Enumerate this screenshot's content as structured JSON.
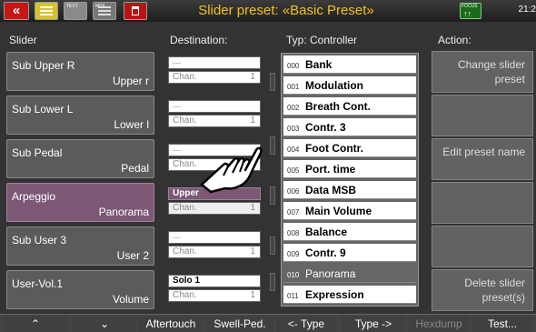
{
  "titlebar": {
    "title": "Slider preset: «Basic Preset»",
    "back_icon": "double-chevron-left-icon",
    "clock": "21:2",
    "icon_mini_labels": [
      "TEXT",
      "MIDI"
    ],
    "green_icon_label": "FOCUS"
  },
  "headers": {
    "slider": "Slider",
    "destination": "Destination:",
    "type": "Typ:  Controller",
    "action": "Action:"
  },
  "sliders": [
    {
      "name": "Sub Upper R",
      "sub": "Upper r"
    },
    {
      "name": "Sub Lower L",
      "sub": "Lower l"
    },
    {
      "name": "Sub Pedal",
      "sub": "Pedal"
    },
    {
      "name": "Arpeggio",
      "sub": "Panorama"
    },
    {
      "name": "Sub User 3",
      "sub": "User 2"
    },
    {
      "name": "User-Vol.1",
      "sub": "Volume"
    }
  ],
  "destinations": [
    {
      "top": "---",
      "chan": "Chan.",
      "num": "1"
    },
    {
      "top": "---",
      "chan": "Chan.",
      "num": "1"
    },
    {
      "top": "---",
      "chan": "Chan.",
      "num": "1"
    },
    {
      "top": "Upper",
      "chan": "Chan.",
      "num": "1"
    },
    {
      "top": "---",
      "chan": "Chan.",
      "num": "1"
    },
    {
      "top": "Solo 1",
      "chan": "Chan.",
      "num": "1"
    }
  ],
  "types": [
    {
      "num": "000",
      "label": "Bank"
    },
    {
      "num": "001",
      "label": "Modulation"
    },
    {
      "num": "002",
      "label": "Breath Cont."
    },
    {
      "num": "003",
      "label": "Contr. 3"
    },
    {
      "num": "004",
      "label": "Foot Contr."
    },
    {
      "num": "005",
      "label": "Port. time"
    },
    {
      "num": "006",
      "label": "Data MSB"
    },
    {
      "num": "007",
      "label": "Main Volume"
    },
    {
      "num": "008",
      "label": "Balance"
    },
    {
      "num": "009",
      "label": "Contr. 9"
    },
    {
      "num": "010",
      "label": "Panorama"
    },
    {
      "num": "011",
      "label": "Expression"
    }
  ],
  "actions": [
    {
      "label": "Change slider preset"
    },
    {
      "label": ""
    },
    {
      "label": "Edit preset name"
    },
    {
      "label": ""
    },
    {
      "label": ""
    },
    {
      "label": "Delete slider preset(s)"
    }
  ],
  "bottom": {
    "up": "≈",
    "down": "≈",
    "aftertouch": "Aftertouch",
    "swell": "Swell-Ped.",
    "type_prev": "<- Type",
    "type_next": "Type ->",
    "hexdump": "Hexdump",
    "test": "Test..."
  },
  "colors": {
    "title": "#f0c020",
    "selected_row": "#7c5875",
    "back_button": "#c81616"
  }
}
